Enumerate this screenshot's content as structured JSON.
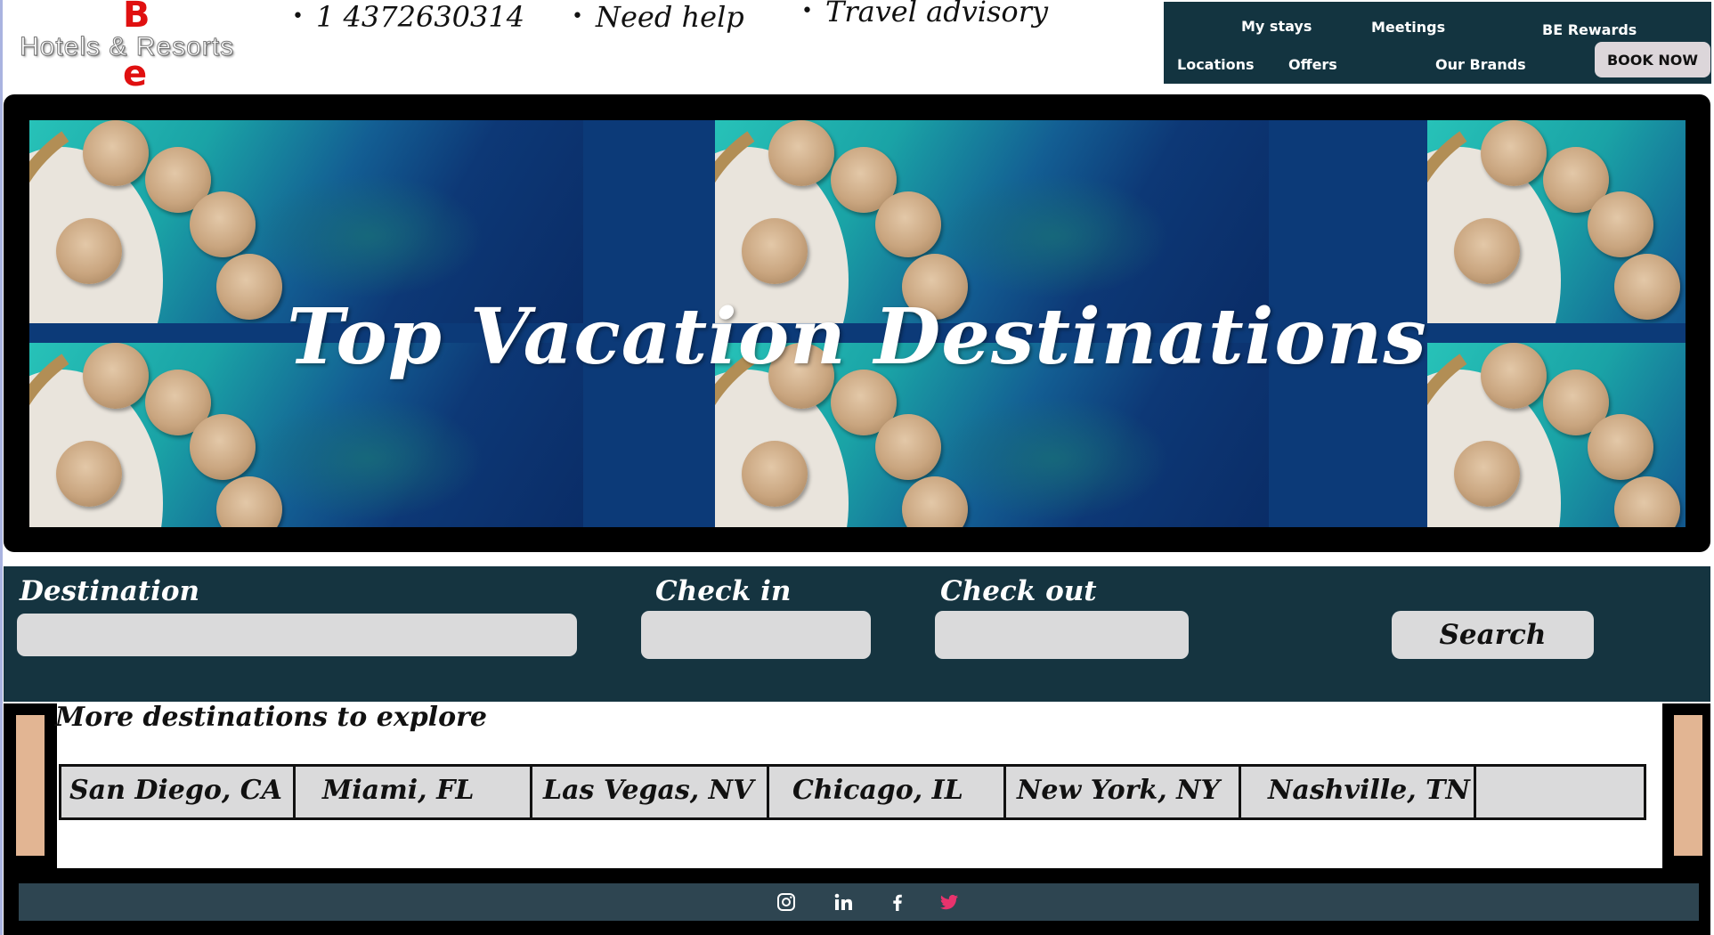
{
  "brand": {
    "letter_top": "B",
    "name": "Hotels & Resorts",
    "letter_bottom": "e"
  },
  "contacts": [
    {
      "label": "1 4372630314"
    },
    {
      "label": "Need help"
    },
    {
      "label": "Travel advisory"
    }
  ],
  "nav": {
    "my_stays": "My stays",
    "meetings": "Meetings",
    "be_rewards": "BE Rewards",
    "locations": "Locations",
    "offers": "Offers",
    "our_brands": "Our Brands",
    "book_now": "BOOK NOW"
  },
  "hero": {
    "title": "Top Vacation Destinations"
  },
  "search": {
    "destination_label": "Destination",
    "destination_value": "",
    "checkin_label": "Check in",
    "checkin_value": "",
    "checkout_label": "Check out",
    "checkout_value": "",
    "button_label": "Search"
  },
  "more": {
    "title": "More destinations to explore",
    "destinations": [
      "San Diego, CA",
      "Miami, FL",
      "Las Vegas, NV",
      "Chicago, IL",
      "New York,  NY",
      "Nashville, TN"
    ]
  },
  "footer": {
    "social_icons": [
      "instagram-icon",
      "linkedin-icon",
      "facebook-icon",
      "twitter-icon"
    ],
    "twitter_color": "#e8336d"
  },
  "colors": {
    "nav_bg": "#133440",
    "search_bg": "#153440",
    "footer_bg": "#2e4551",
    "accent_red": "#e01010",
    "side_bar": "#e2b593"
  }
}
